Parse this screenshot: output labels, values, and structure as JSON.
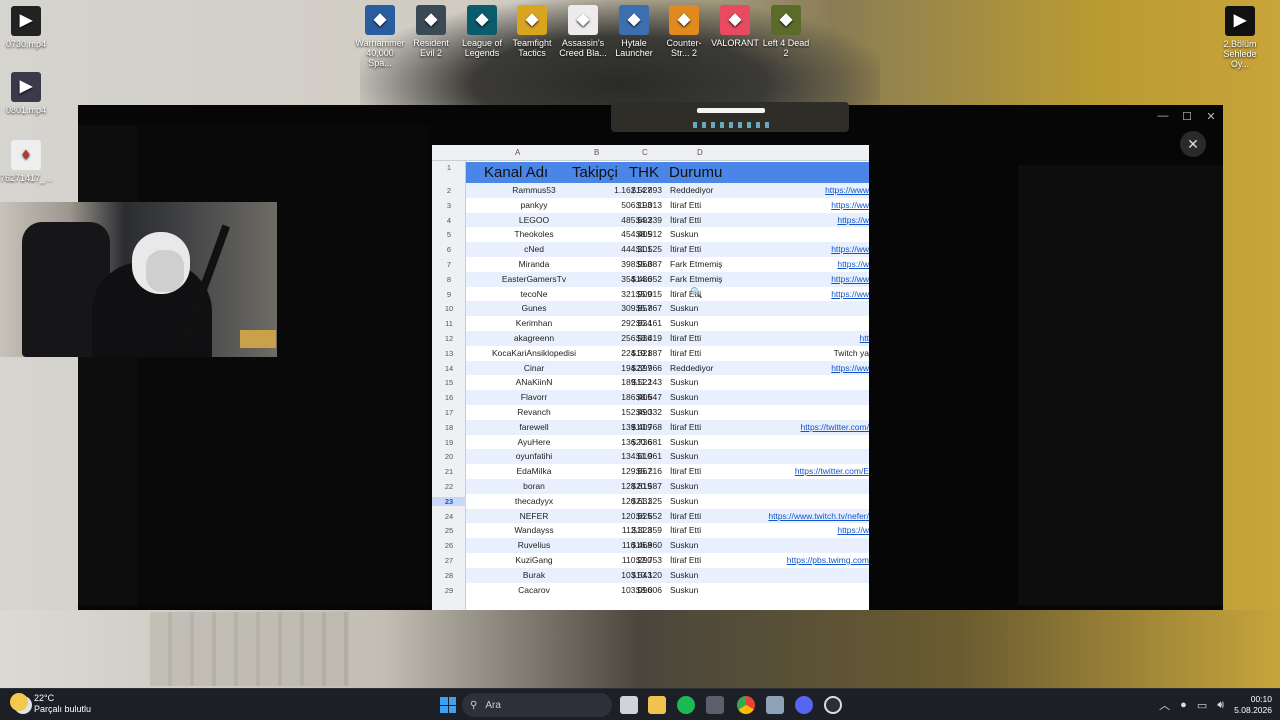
{
  "desktop": {
    "left_icons": [
      {
        "label": "0730.mp4"
      },
      {
        "label": "0801.mp4"
      },
      {
        "label": "76271417_..."
      }
    ],
    "top_icons": [
      {
        "label": "Warhammer 40,000 Spa...",
        "icon": "warhammer-icon",
        "color": "#2a5d9f"
      },
      {
        "label": "Resident Evil 2",
        "icon": "resident-evil-icon",
        "color": "#3a4a55"
      },
      {
        "label": "League of Legends",
        "icon": "league-of-legends-icon",
        "color": "#0a5b6b"
      },
      {
        "label": "Teamfight Tactics",
        "icon": "teamfight-tactics-icon",
        "color": "#d9a520"
      },
      {
        "label": "Assassin's Creed Bla...",
        "icon": "assassins-creed-icon",
        "color": "#ececec"
      },
      {
        "label": "Hytale Launcher",
        "icon": "hytale-icon",
        "color": "#3c6fb0"
      },
      {
        "label": "Counter-Str... 2",
        "icon": "counter-strike-icon",
        "color": "#e08a1e"
      },
      {
        "label": "VALORANT",
        "icon": "valorant-icon",
        "color": "#e84a5f"
      },
      {
        "label": "Left 4 Dead 2",
        "icon": "left-4-dead-icon",
        "color": "#5b6b2a"
      }
    ],
    "right_icon": {
      "label": "2.Bölüm Sehlede Oy..."
    }
  },
  "window": {
    "controls": [
      "—",
      "☐",
      "✕"
    ],
    "close_label": "✕"
  },
  "sheet": {
    "columns": [
      "A",
      "B",
      "C",
      "D"
    ],
    "headers": {
      "name": "Kanal Adı",
      "followers": "Takipçi",
      "thk": "THK",
      "status": "Durumu"
    },
    "rows": [
      {
        "n": "2",
        "name": "Rammus53",
        "followers": "1.162.527",
        "thk": "$14.893",
        "status": "Reddediyor",
        "link": "https://www"
      },
      {
        "n": "3",
        "name": "pankyy",
        "followers": "506.193",
        "thk": "$1.013",
        "status": "İtiraf Etti",
        "link": "https://ww"
      },
      {
        "n": "4",
        "name": "LEGOO",
        "followers": "485.693",
        "thk": "$4.239",
        "status": "İtiraf Etti",
        "link": "https://w"
      },
      {
        "n": "5",
        "name": "Theokoles",
        "followers": "454.405",
        "thk": "$8.912",
        "status": "Suskun",
        "link": ""
      },
      {
        "n": "6",
        "name": "cNed",
        "followers": "444.301",
        "thk": "$1.525",
        "status": "İtiraf Etti",
        "link": "https://ww"
      },
      {
        "n": "7",
        "name": "Miranda",
        "followers": "398.968",
        "thk": "$5.087",
        "status": "Fark Etmemiş",
        "link": "https://w"
      },
      {
        "n": "8",
        "name": "EasterGamersTv",
        "followers": "354.486",
        "thk": "$14.052",
        "status": "Fark Etmemiş",
        "link": "https://ww"
      },
      {
        "n": "9",
        "name": "tecoNe",
        "followers": "321.909",
        "thk": "$5.015",
        "status": "İtiraf Etti",
        "link": "https://ww"
      },
      {
        "n": "10",
        "name": "Gunes",
        "followers": "309.857",
        "thk": "$5.867",
        "status": "Suskun",
        "link": ""
      },
      {
        "n": "11",
        "name": "Kerimhan",
        "followers": "292.634",
        "thk": "$5.161",
        "status": "Suskun",
        "link": ""
      },
      {
        "n": "12",
        "name": "akagreenn",
        "followers": "256.536",
        "thk": "$8.419",
        "status": "İtiraf Etti",
        "link": "htt"
      },
      {
        "n": "13",
        "name": "KocaKariAnsiklopedisi",
        "followers": "224.321",
        "thk": "$19.887",
        "status": "İtiraf Etti",
        "link": "Twitch ya",
        "plain": true
      },
      {
        "n": "14",
        "name": "Cinar",
        "followers": "194.397",
        "thk": "$22.966",
        "status": "Reddediyor",
        "link": "https://ww"
      },
      {
        "n": "15",
        "name": "ANaKiinN",
        "followers": "189.522",
        "thk": "$11.143",
        "status": "Suskun",
        "link": ""
      },
      {
        "n": "16",
        "name": "Flavorr",
        "followers": "186.405",
        "thk": "$8.647",
        "status": "Suskun",
        "link": ""
      },
      {
        "n": "17",
        "name": "Revanch",
        "followers": "152.490",
        "thk": "$6.332",
        "status": "Suskun",
        "link": ""
      },
      {
        "n": "18",
        "name": "farewell",
        "followers": "139.409",
        "thk": "$10.768",
        "status": "İtiraf Etti",
        "link": "https://twitter.com/"
      },
      {
        "n": "19",
        "name": "AyuHere",
        "followers": "136.736",
        "thk": "$20.681",
        "status": "Suskun",
        "link": ""
      },
      {
        "n": "20",
        "name": "oyunfatihi",
        "followers": "134.610",
        "thk": "$1.961",
        "status": "Suskun",
        "link": ""
      },
      {
        "n": "21",
        "name": "EdaMilka",
        "followers": "129.667",
        "thk": "$5.216",
        "status": "İtiraf Etti",
        "link": "https://twitter.com/E"
      },
      {
        "n": "22",
        "name": "boran",
        "followers": "128.819",
        "thk": "$20.587",
        "status": "Suskun",
        "link": ""
      },
      {
        "n": "23",
        "name": "thecadyyx",
        "followers": "120.631",
        "thk": "$21.325",
        "status": "Suskun",
        "link": ""
      },
      {
        "n": "24",
        "name": "NEFER",
        "followers": "120.625",
        "thk": "$6.652",
        "status": "İtiraf Etti",
        "link": "https://www.twitch.tv/nefer/"
      },
      {
        "n": "25",
        "name": "Wandayss",
        "followers": "112.323",
        "thk": "$11.859",
        "status": "İtiraf Etti",
        "link": "https://w"
      },
      {
        "n": "26",
        "name": "Ruvelius",
        "followers": "110.468",
        "thk": "$16.960",
        "status": "Suskun",
        "link": ""
      },
      {
        "n": "27",
        "name": "KuziGang",
        "followers": "110.290",
        "thk": "$2.753",
        "status": "İtiraf Etti",
        "link": "https://pbs.twimg.com"
      },
      {
        "n": "28",
        "name": "Burak",
        "followers": "103.543",
        "thk": "$10.120",
        "status": "Suskun",
        "link": ""
      },
      {
        "n": "29",
        "name": "Cacarov",
        "followers": "103.096",
        "thk": "$8.006",
        "status": "Suskun",
        "link": ""
      }
    ]
  },
  "taskbar": {
    "weather_temp": "22°C",
    "weather_text": "Parçalı bulutlu",
    "search_placeholder": "Ara",
    "time": "00:10",
    "date": "5.08.2026"
  }
}
